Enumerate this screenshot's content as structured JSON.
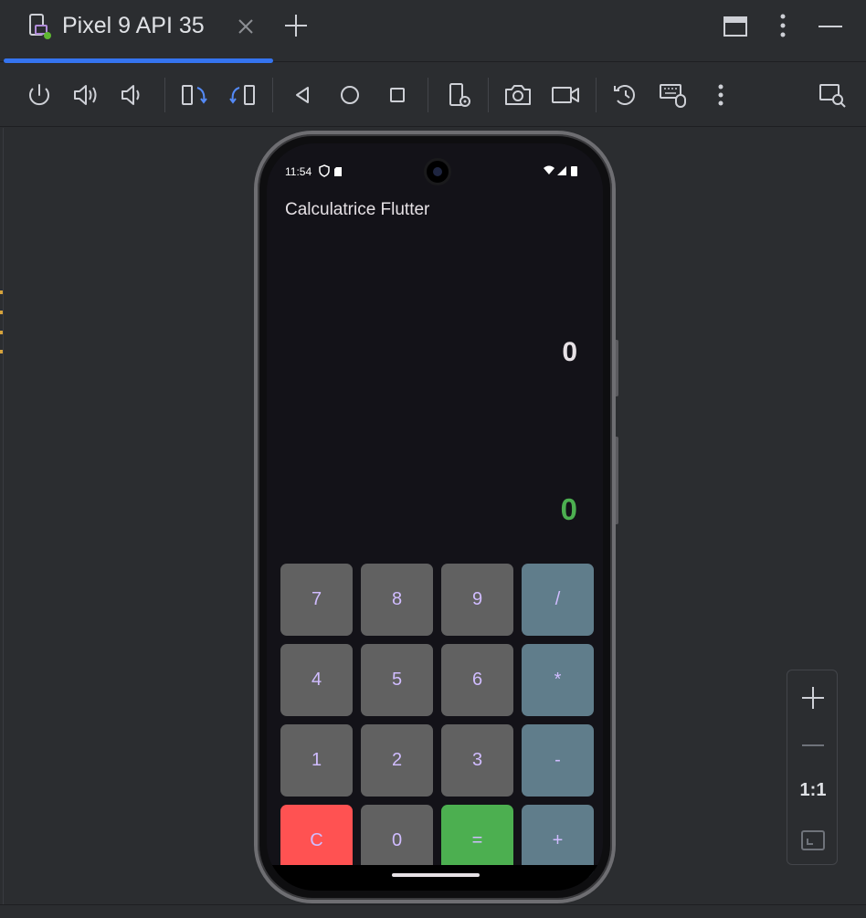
{
  "window": {
    "tab_title": "Pixel 9 API 35",
    "icons": {
      "device": "device-icon",
      "close": "close-icon",
      "add": "plus-icon",
      "restore": "window-restore-icon",
      "more": "more-vertical-icon",
      "minimize": "minimize-icon"
    }
  },
  "toolbar": {
    "items": [
      "power-icon",
      "volume-up-icon",
      "volume-down-icon",
      "rotate-left-icon",
      "rotate-right-icon",
      "back-icon",
      "home-icon",
      "overview-icon",
      "device-settings-icon",
      "camera-icon",
      "screen-record-icon",
      "snapshot-icon",
      "keyboard-mouse-icon",
      "more-vertical-icon",
      "device-search-icon"
    ]
  },
  "device": {
    "status_time": "11:54",
    "app_title": "Calculatrice Flutter",
    "expression": "0",
    "result": "0",
    "keys": [
      {
        "label": "7",
        "kind": "num"
      },
      {
        "label": "8",
        "kind": "num"
      },
      {
        "label": "9",
        "kind": "num"
      },
      {
        "label": "/",
        "kind": "op"
      },
      {
        "label": "4",
        "kind": "num"
      },
      {
        "label": "5",
        "kind": "num"
      },
      {
        "label": "6",
        "kind": "num"
      },
      {
        "label": "*",
        "kind": "op"
      },
      {
        "label": "1",
        "kind": "num"
      },
      {
        "label": "2",
        "kind": "num"
      },
      {
        "label": "3",
        "kind": "num"
      },
      {
        "label": "-",
        "kind": "op"
      },
      {
        "label": "C",
        "kind": "clear"
      },
      {
        "label": "0",
        "kind": "num"
      },
      {
        "label": "=",
        "kind": "equals"
      },
      {
        "label": "+",
        "kind": "op"
      }
    ]
  },
  "zoom": {
    "actual_size_label": "1:1"
  },
  "colors": {
    "accent": "#3574f0",
    "result_green": "#4caf50",
    "key_text": "#d0bcff",
    "key_num": "#616161",
    "key_op": "#607d8b",
    "key_clear": "#ff5252",
    "key_equals": "#4caf50"
  }
}
